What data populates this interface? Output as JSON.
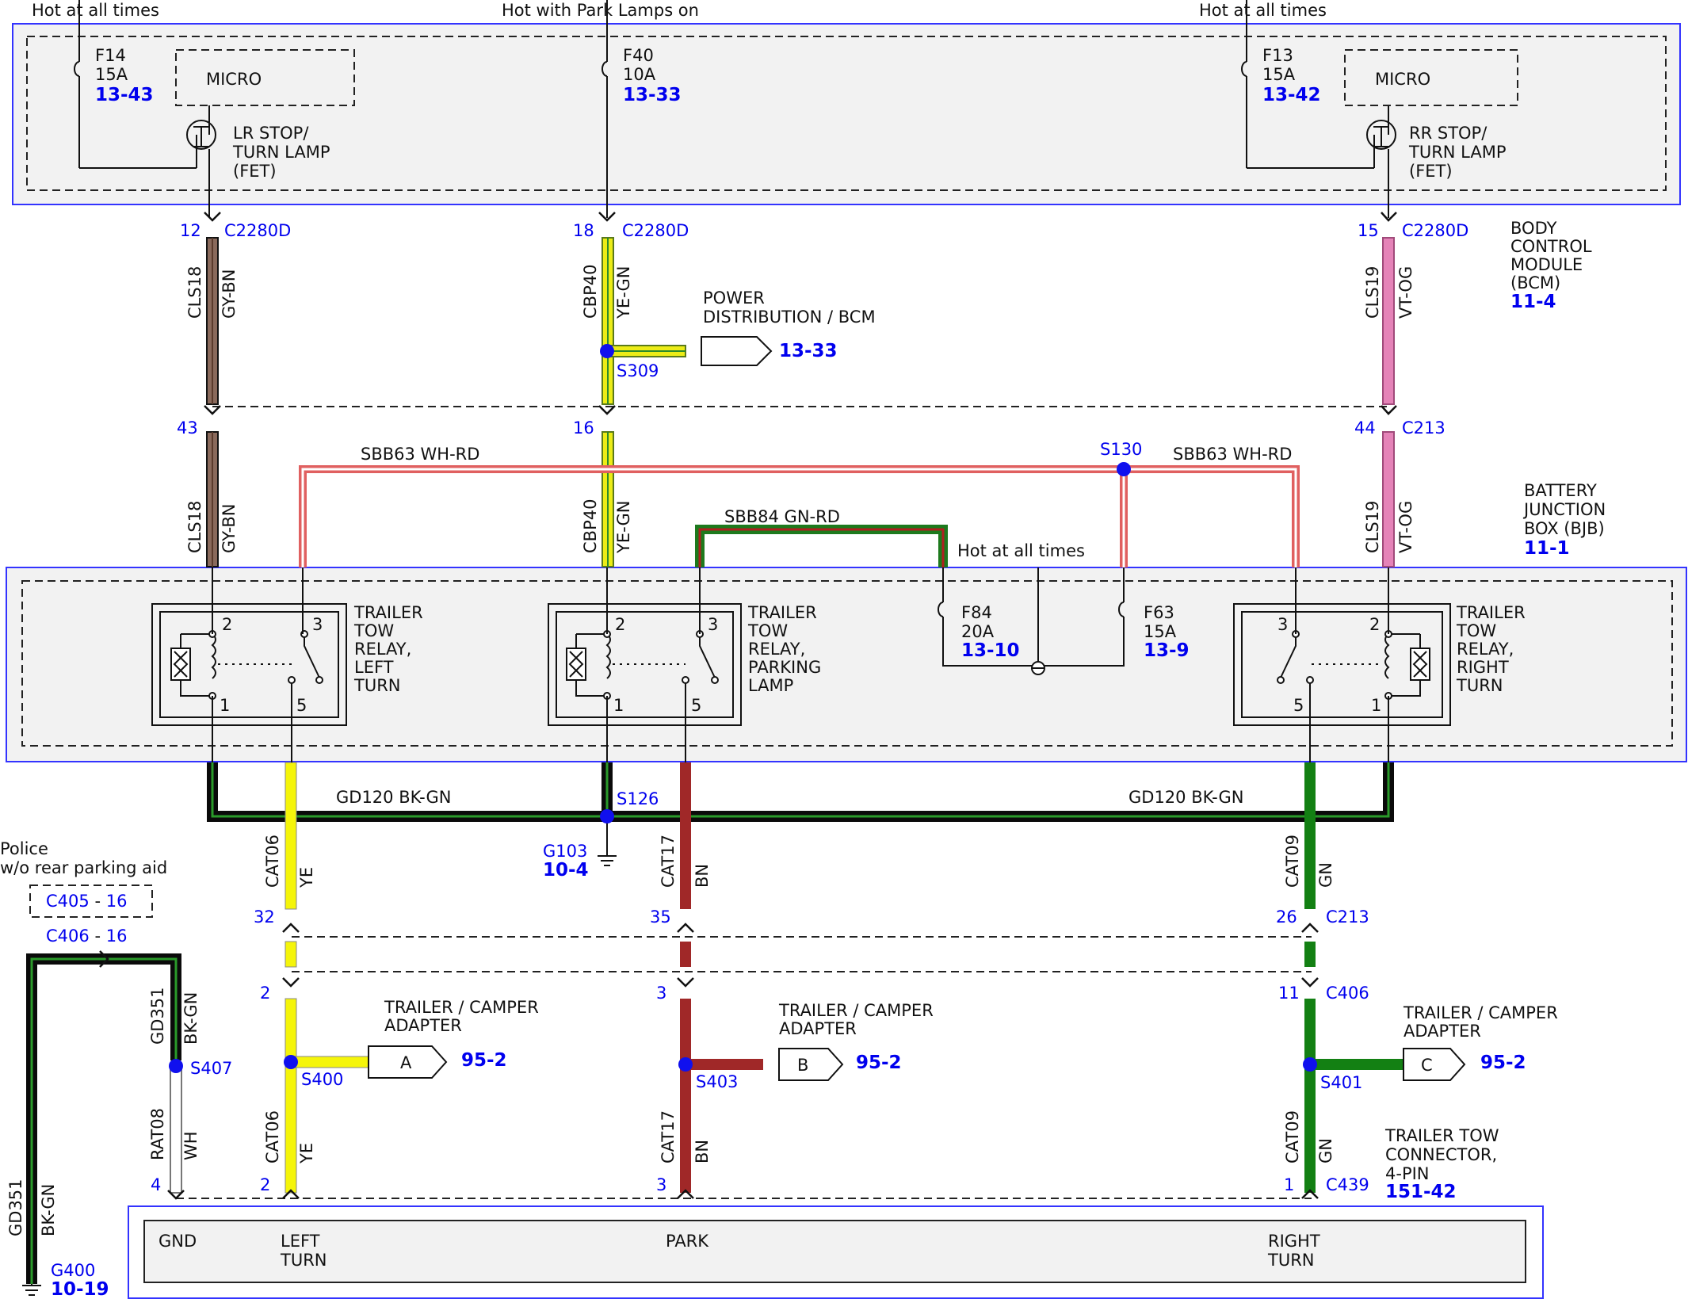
{
  "feeds": {
    "left": "Hot at all times",
    "middle": "Hot with Park Lamps on",
    "right": "Hot at all times",
    "bjb": "Hot at all times"
  },
  "bcm": {
    "fuse_f14": {
      "name": "F14",
      "rating": "15A",
      "ref": "13-43"
    },
    "fuse_f40": {
      "name": "F40",
      "rating": "10A",
      "ref": "13-33"
    },
    "fuse_f13": {
      "name": "F13",
      "rating": "15A",
      "ref": "13-42"
    },
    "micro_left": "MICRO",
    "micro_right": "MICRO",
    "fet_left": [
      "LR STOP/",
      "TURN LAMP",
      "(FET)"
    ],
    "fet_right": [
      "RR STOP/",
      "TURN LAMP",
      "(FET)"
    ],
    "module_name": [
      "BODY",
      "CONTROL",
      "MODULE",
      "(BCM)"
    ],
    "module_ref": "11-4"
  },
  "connectors": {
    "c2280d": "C2280D",
    "c213": "C213",
    "c406": "C406",
    "c439": "C439",
    "c405_box": "C405",
    "c406_left": "C406",
    "c405_pin": "16",
    "c406_left_pin": "16",
    "c405_sep": "-",
    "c406_sep": "-",
    "pins": {
      "l12": "12",
      "m18": "18",
      "r15": "15",
      "l43": "43",
      "m16": "16",
      "r44": "44",
      "l32": "32",
      "m35": "35",
      "r26": "26",
      "l2a": "2",
      "m3a": "3",
      "r11": "11",
      "g4": "4",
      "l2b": "2",
      "m3b": "3",
      "r1": "1"
    }
  },
  "wires": {
    "cls18_circuit": "CLS18",
    "cls18_color": "GY-BN",
    "cbp40_circuit": "CBP40",
    "cbp40_color": "YE-GN",
    "cls19_circuit": "CLS19",
    "cls19_color": "VT-OG",
    "sbb63_left": "SBB63  WH-RD",
    "sbb63_right": "SBB63  WH-RD",
    "sbb84": "SBB84  GN-RD",
    "gd120_left": "GD120  BK-GN",
    "gd120_right": "GD120  BK-GN",
    "cat06_circuit": "CAT06",
    "cat06_color": "YE",
    "cat17_circuit": "CAT17",
    "cat17_color": "BN",
    "cat09_circuit": "CAT09",
    "cat09_color": "GN",
    "gd351_circuit": "GD351",
    "gd351_color": "BK-GN",
    "rat08_circuit": "RAT08",
    "rat08_color": "WH"
  },
  "splices": {
    "s309": "S309",
    "s130": "S130",
    "s126": "S126",
    "s400": "S400",
    "s403": "S403",
    "s401": "S401",
    "s407": "S407"
  },
  "power_dist": {
    "label": [
      "POWER",
      "DISTRIBUTION / BCM"
    ],
    "ref": "13-33"
  },
  "bjb": {
    "name": [
      "BATTERY",
      "JUNCTION",
      "BOX (BJB)"
    ],
    "ref": "11-1",
    "fuse_f84": {
      "name": "F84",
      "rating": "20A",
      "ref": "13-10"
    },
    "fuse_f63": {
      "name": "F63",
      "rating": "15A",
      "ref": "13-9"
    },
    "relay_left": {
      "label": [
        "TRAILER",
        "TOW",
        "RELAY,",
        "LEFT",
        "TURN"
      ],
      "pins": [
        "2",
        "3",
        "1",
        "5"
      ]
    },
    "relay_mid": {
      "label": [
        "TRAILER",
        "TOW",
        "RELAY,",
        "PARKING",
        "LAMP"
      ],
      "pins": [
        "2",
        "3",
        "1",
        "5"
      ]
    },
    "relay_right": {
      "label": [
        "TRAILER",
        "TOW",
        "RELAY,",
        "RIGHT",
        "TURN"
      ],
      "pins": [
        "3",
        "2",
        "5",
        "1"
      ]
    }
  },
  "grounds": {
    "g103": {
      "name": "G103",
      "ref": "10-4"
    },
    "g400": {
      "name": "G400",
      "ref": "10-19"
    }
  },
  "police_note": [
    "Police",
    "w/o rear parking aid"
  ],
  "adapters": {
    "a": {
      "letter": "A",
      "ref": "95-2",
      "label": [
        "TRAILER / CAMPER",
        "ADAPTER"
      ]
    },
    "b": {
      "letter": "B",
      "ref": "95-2",
      "label": [
        "TRAILER / CAMPER",
        "ADAPTER"
      ]
    },
    "c": {
      "letter": "C",
      "ref": "95-2",
      "label": [
        "TRAILER / CAMPER",
        "ADAPTER"
      ]
    }
  },
  "connector_4pin": {
    "label": [
      "TRAILER TOW",
      "CONNECTOR,",
      "4-PIN"
    ],
    "ref": "151-42",
    "terminals": {
      "gnd": [
        "GND"
      ],
      "left": [
        "LEFT",
        "TURN"
      ],
      "park": [
        "PARK"
      ],
      "right": [
        "RIGHT",
        "TURN"
      ]
    }
  },
  "colors": {
    "module_border": "#3333ff",
    "module_fill": "#f2f2f2",
    "reference_blue": "#0000ee",
    "gy_bn": "#8a6a5c",
    "ye_gn": "#ecec16",
    "vt_og": "#e583b8",
    "wh_rd": "#e06060",
    "gn_rd": "#1d7a1d",
    "bk_gn": "#0a0a0a",
    "ye": "#f5f50a",
    "bn": "#a02828",
    "gn": "#138013",
    "wh": "#d8d8d8"
  }
}
